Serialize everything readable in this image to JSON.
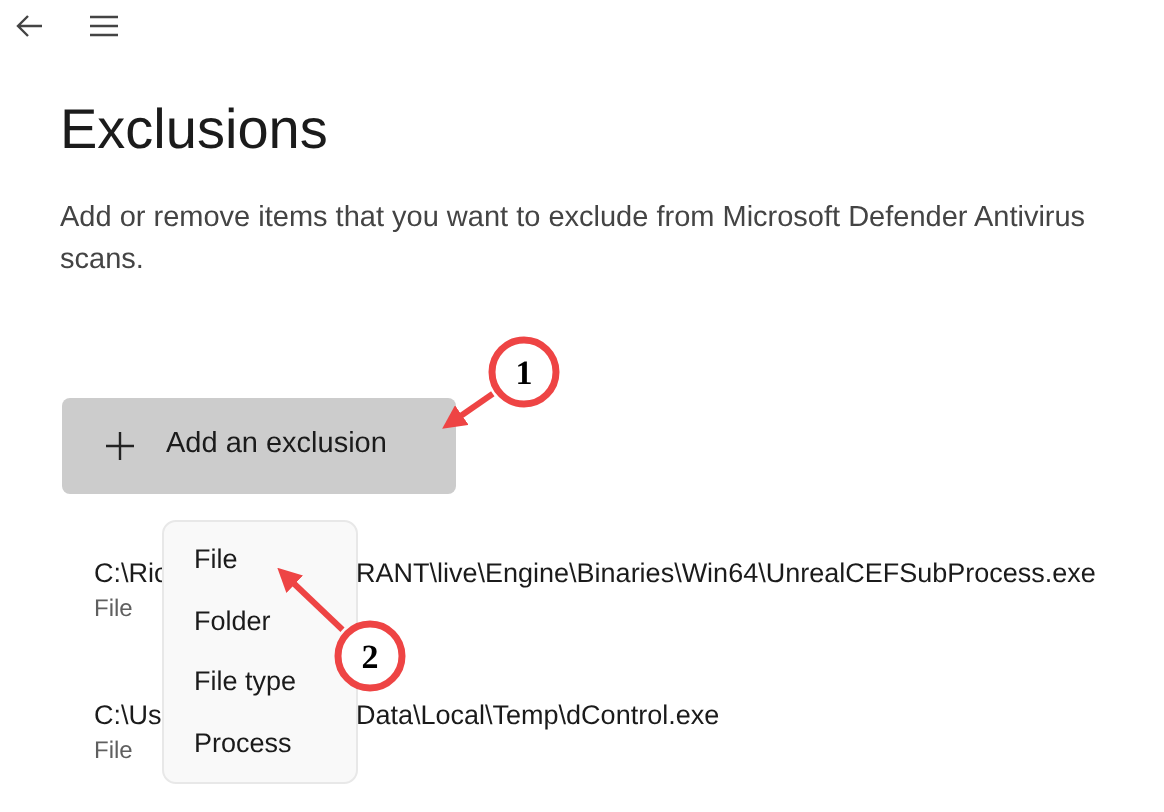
{
  "title": "Exclusions",
  "description": "Add or remove items that you want to exclude from Microsoft Defender Antivirus scans.",
  "add_button": {
    "label": "Add an exclusion"
  },
  "exclusions": [
    {
      "path_visible_start": "C:\\Ric",
      "path_visible_end": "RANT\\live\\Engine\\Binaries\\Win64\\UnrealCEFSubProcess.exe",
      "type": "File"
    },
    {
      "path_visible_start": "C:\\Us",
      "path_visible_end": "Data\\Local\\Temp\\dControl.exe",
      "type": "File"
    }
  ],
  "menu": {
    "items": [
      "File",
      "Folder",
      "File type",
      "Process"
    ]
  },
  "annotations": [
    {
      "label": "1"
    },
    {
      "label": "2"
    }
  ]
}
